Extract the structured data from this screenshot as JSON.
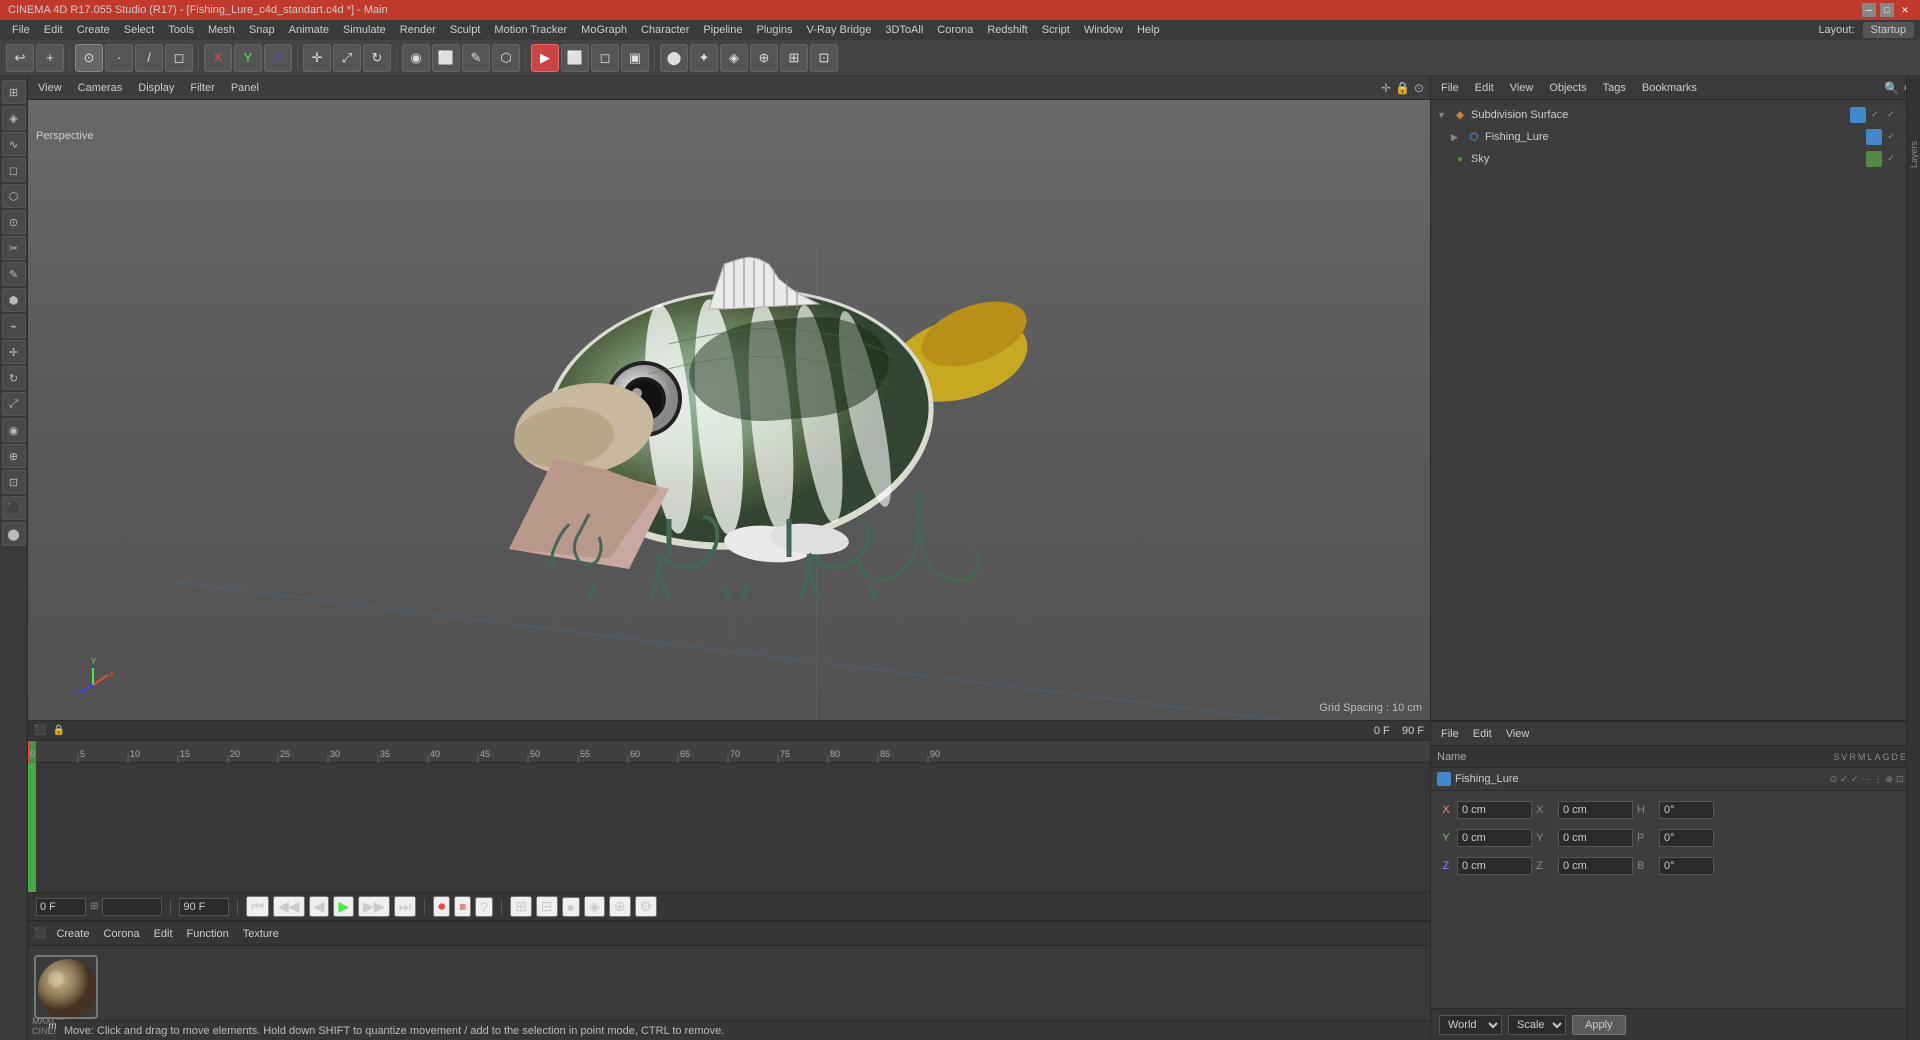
{
  "window": {
    "title": "CINEMA 4D R17.055 Studio (R17) - [Fishing_Lure_c4d_standart.c4d *] - Main",
    "layout": "Layout:",
    "layout_value": "Startup"
  },
  "menu_bar": {
    "items": [
      "File",
      "Edit",
      "Create",
      "Select",
      "Tools",
      "Mesh",
      "Snap",
      "Animate",
      "Simulate",
      "Render",
      "Sculpt",
      "Motion Tracker",
      "MoGraph",
      "Character",
      "Pipeline",
      "Plugins",
      "V-Ray Bridge",
      "3DToAll",
      "Corona",
      "Redshift",
      "Script",
      "Window",
      "Help"
    ]
  },
  "viewport": {
    "label": "Perspective",
    "menus": [
      "View",
      "Cameras",
      "Display",
      "Filter",
      "Panel"
    ],
    "grid_spacing": "Grid Spacing : 10 cm"
  },
  "object_manager": {
    "menus": [
      "File",
      "Edit",
      "View",
      "Objects",
      "Tags",
      "Bookmarks"
    ],
    "objects": [
      {
        "name": "Subdivision Surface",
        "type": "subdivsurface",
        "level": 0,
        "color": "#4488cc"
      },
      {
        "name": "Fishing_Lure",
        "type": "mesh",
        "level": 1,
        "color": "#4488cc"
      },
      {
        "name": "Sky",
        "type": "sky",
        "level": 0,
        "color": "#558844"
      }
    ]
  },
  "properties": {
    "menus": [
      "File",
      "Edit",
      "View"
    ],
    "name_label": "Name",
    "object_name": "Fishing_Lure",
    "columns": [
      "S",
      "V",
      "R",
      "M",
      "L",
      "A",
      "G",
      "D",
      "E",
      "X"
    ],
    "coords": {
      "X": {
        "label": "X",
        "pos": "0 cm",
        "size": "0 cm"
      },
      "Y": {
        "label": "Y",
        "pos": "0 cm",
        "size": "0 cm"
      },
      "Z": {
        "label": "Z",
        "pos": "0 cm",
        "size": "0 cm"
      }
    },
    "H": "0°",
    "P": "0°",
    "B": "0°",
    "coord_system": "World",
    "scale_mode": "Scale",
    "apply_btn": "Apply"
  },
  "timeline": {
    "frame_start": "0 F",
    "frame_end": "90 F",
    "current_frame": "0 F",
    "ruler_marks": [
      "0",
      "5",
      "10",
      "15",
      "20",
      "25",
      "30",
      "35",
      "40",
      "45",
      "50",
      "55",
      "60",
      "65",
      "70",
      "75",
      "80",
      "85",
      "90"
    ]
  },
  "material_editor": {
    "menus": [
      "Create",
      "Corona",
      "Edit",
      "Function",
      "Texture"
    ],
    "material_name": "mat_Fis"
  },
  "status_bar": {
    "text": "Move: Click and drag to move elements. Hold down SHIFT to quantize movement / add to the selection in point mode, CTRL to remove."
  },
  "toolbar_buttons": [
    "undo",
    "redo",
    "new",
    "open",
    "save",
    "render",
    "renderregion",
    "renderactive",
    "renderview",
    "renderall",
    "x-axis",
    "y-axis",
    "z-axis",
    "all-axes",
    "move",
    "scale",
    "rotate",
    "select",
    "live-selection",
    "rectangle-selection",
    "polygon-selection",
    "edge-selection",
    "point-mode",
    "edge-mode",
    "polygon-mode",
    "object-mode",
    "knife",
    "bridge",
    "extrude",
    "bevel",
    "loop-cut",
    "slip",
    "mirror",
    "symmetry",
    "subdivide",
    "soft-selection",
    "magnet",
    "shrink-wrap",
    "transfer"
  ],
  "icons": {
    "subdivsurface": "◈",
    "mesh": "⬡",
    "sky": "●",
    "move": "✛",
    "rotate": "↻",
    "scale": "⤢"
  }
}
